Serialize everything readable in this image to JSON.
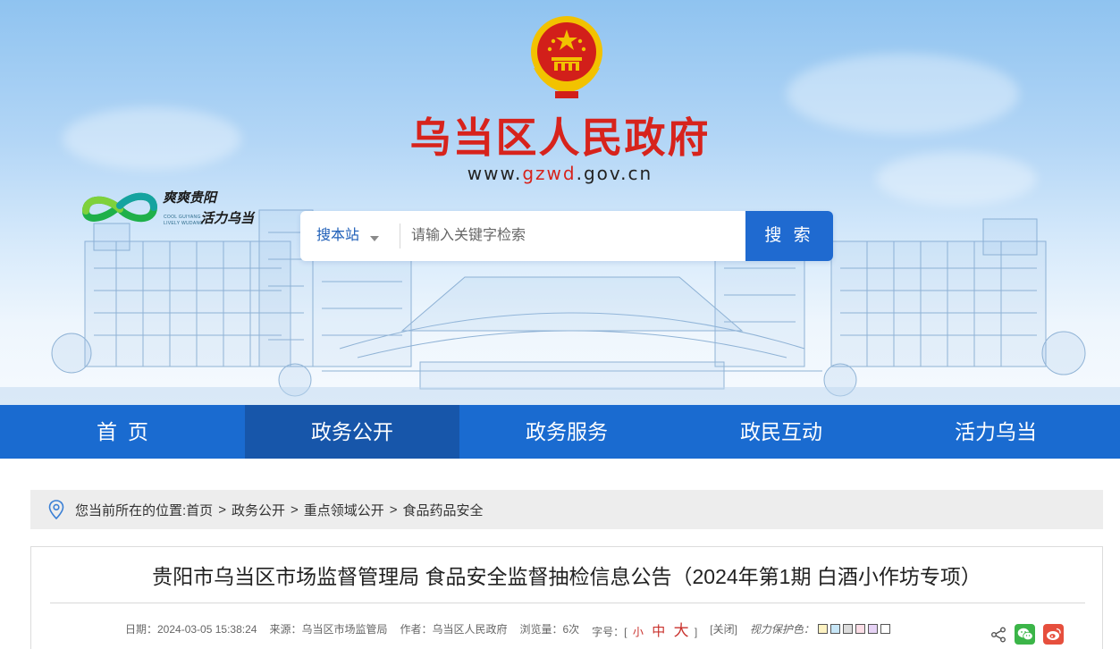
{
  "header": {
    "site_title": "乌当区人民政府",
    "url_prefix": "www.",
    "url_highlight": "gzwd",
    "url_suffix": ".gov.cn",
    "slogan_cn_line1": "爽爽贵阳",
    "slogan_cn_line2": "活力乌当",
    "slogan_en_line1": "COOL GUIYANG",
    "slogan_en_line2": "LIVELY WUDANG"
  },
  "search": {
    "scope_label": "搜本站",
    "placeholder": "请输入关键字检索",
    "button_label": "搜 索"
  },
  "nav": {
    "items": [
      {
        "label": "首页"
      },
      {
        "label": "政务公开"
      },
      {
        "label": "政务服务"
      },
      {
        "label": "政民互动"
      },
      {
        "label": "活力乌当"
      }
    ],
    "active_index": 1
  },
  "breadcrumb": {
    "prefix": "您当前所在的位置:",
    "items": [
      "首页",
      "政务公开",
      "重点领域公开",
      "食品药品安全"
    ],
    "separator": ">"
  },
  "article": {
    "title": "贵阳市乌当区市场监督管理局 食品安全监督抽检信息公告（2024年第1期 白酒小作坊专项）",
    "date": "日期：2024-03-05 15:38:24",
    "source": "来源：乌当区市场监管局",
    "author": "作者：乌当区人民政府",
    "views": "浏览量：6次",
    "font_size_label": "字号：[",
    "font_small": "小",
    "font_medium": "中",
    "font_large": "大",
    "font_close_bracket": "]",
    "close_label": "[关闭]",
    "eye_label": "视力保护色：",
    "eye_colors": [
      "#fdf2c2",
      "#c7e6f7",
      "#dcdcdc",
      "#fbdde6",
      "#e6d2f5",
      "#ffffff"
    ]
  },
  "colors": {
    "brand_red": "#d7231c",
    "nav_blue": "#1a6bd0",
    "nav_active": "#1756aa",
    "search_button": "#1f6ad0"
  },
  "icons": {
    "location": "location-pin-icon",
    "share": "share-icon",
    "wechat": "wechat-icon",
    "weibo": "weibo-icon"
  }
}
